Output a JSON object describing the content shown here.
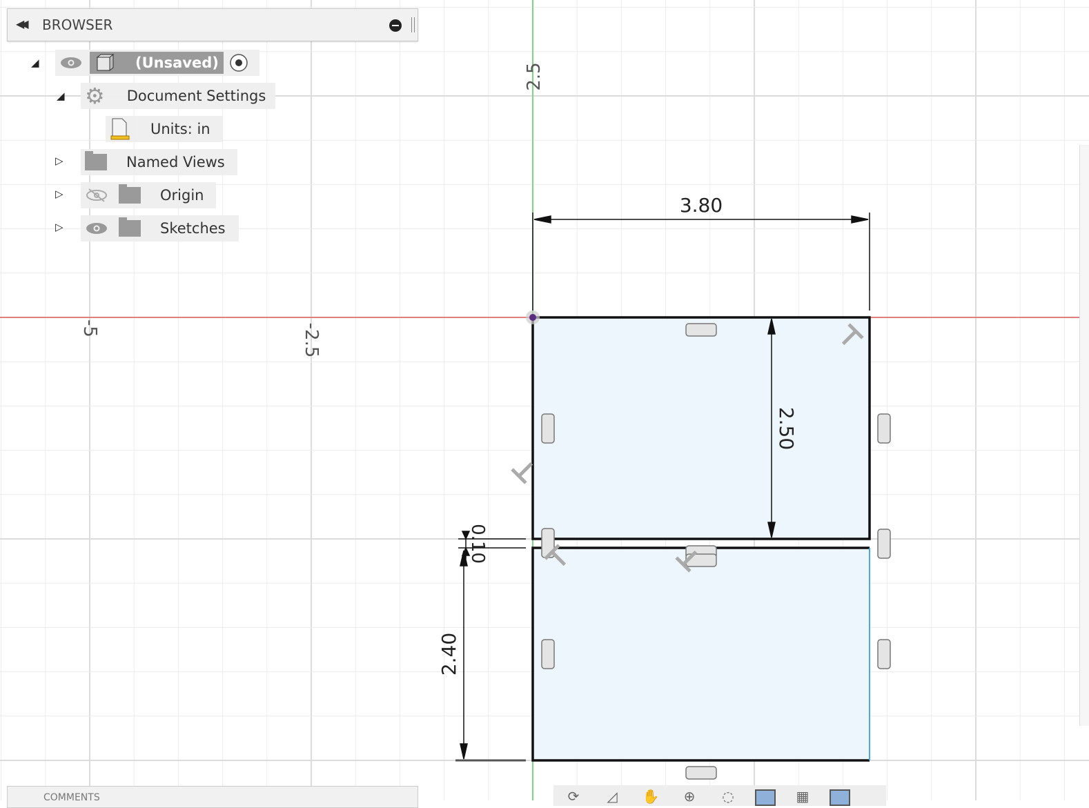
{
  "browser": {
    "title": "BROWSER",
    "items": [
      {
        "label": "(Unsaved)",
        "icon": "component-box-icon",
        "expanded": true
      },
      {
        "label": "Document Settings",
        "icon": "gear-icon",
        "expanded": true
      },
      {
        "label": "Units: in",
        "icon": "units-document-icon"
      },
      {
        "label": "Named Views",
        "icon": "folder-icon",
        "expanded": false
      },
      {
        "label": "Origin",
        "icon": "folder-icon",
        "expanded": false,
        "visible": false
      },
      {
        "label": "Sketches",
        "icon": "folder-icon",
        "expanded": false,
        "visible": true
      }
    ]
  },
  "comments": {
    "title": "COMMENTS"
  },
  "axis_labels": {
    "y_2_5": "2.5",
    "x_neg5": "-5",
    "x_neg2_5": "-2.5"
  },
  "dimensions": {
    "width_top": "3.80",
    "height_top": "2.50",
    "gap": "0.10",
    "height_bottom": "2.40"
  },
  "colors": {
    "x_axis": "#e06060",
    "y_axis": "#5fd35f",
    "profile_fill": "#eef6fd",
    "open_edge": "#4aa8e8"
  },
  "toolbar": {
    "icons": [
      "orbit-icon",
      "look-at-icon",
      "pan-icon",
      "zoom-icon",
      "fit-icon",
      "display-settings-icon",
      "grid-settings-icon",
      "viewports-icon"
    ]
  }
}
